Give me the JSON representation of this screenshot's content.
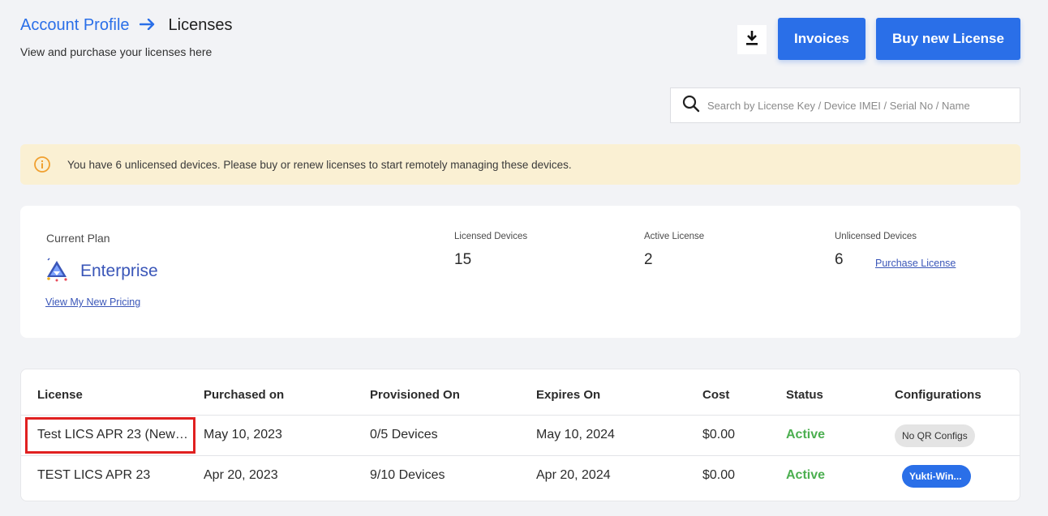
{
  "breadcrumb": {
    "parent": "Account Profile",
    "current": "Licenses"
  },
  "subtitle": "View and purchase your licenses here",
  "toolbar": {
    "download_icon": "download-icon",
    "invoices_label": "Invoices",
    "buy_label": "Buy new License"
  },
  "search": {
    "placeholder": "Search by License Key / Device IMEI / Serial No / Name"
  },
  "alert": {
    "icon": "info-icon",
    "text": "You have 6 unlicensed devices. Please buy or renew licenses to start remotely managing these devices."
  },
  "plan": {
    "label": "Current Plan",
    "name": "Enterprise",
    "pricing_link": "View My New Pricing",
    "stats": {
      "licensed_label": "Licensed Devices",
      "licensed_value": "15",
      "active_label": "Active License",
      "active_value": "2",
      "unlicensed_label": "Unlicensed Devices",
      "unlicensed_value": "6"
    },
    "purchase_link": "Purchase License"
  },
  "table": {
    "headers": {
      "license": "License",
      "purchased": "Purchased on",
      "provisioned": "Provisioned On",
      "expires": "Expires On",
      "cost": "Cost",
      "status": "Status",
      "config": "Configurations"
    },
    "rows": [
      {
        "license": "Test LICS APR 23 (New…",
        "purchased": "May 10, 2023",
        "provisioned": "0/5 Devices",
        "expires": "May 10, 2024",
        "cost": "$0.00",
        "status": "Active",
        "config": "No QR Configs"
      },
      {
        "license": "TEST LICS APR 23",
        "purchased": "Apr 20, 2023",
        "provisioned": "9/10 Devices",
        "expires": "Apr 20, 2024",
        "cost": "$0.00",
        "status": "Active",
        "config": "Yukti-Win..."
      }
    ]
  },
  "colors": {
    "accent": "#2a6fe8",
    "status_active": "#4caf50",
    "alert_bg": "#faf0d3",
    "highlight": "#e02020"
  }
}
